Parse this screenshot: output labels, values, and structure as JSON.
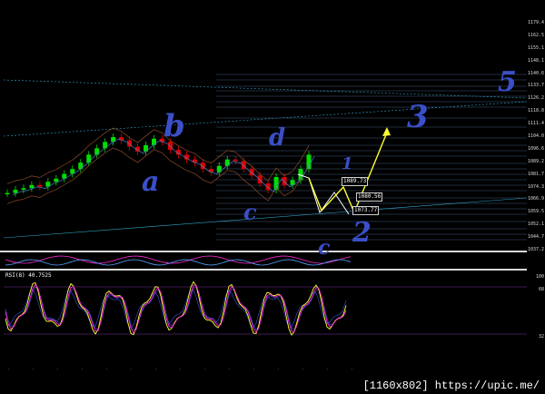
{
  "chart_data": [
    {
      "type": "line",
      "pane": "price",
      "y_axis_ticks": [
        1179.4,
        1162.5,
        1155.1,
        1148.1,
        1140.6,
        1133.7,
        1126.2,
        1118.8,
        1111.4,
        1104.0,
        1096.6,
        1089.2,
        1081.7,
        1074.3,
        1066.9,
        1059.5,
        1052.1,
        1044.7,
        1037.2
      ],
      "value_boxes": [
        "1089.73",
        "1080.56",
        "1073.77"
      ],
      "series": [
        {
          "values": [
            1071,
            1073,
            1074,
            1076,
            1075,
            1078,
            1080,
            1083,
            1086,
            1090,
            1095,
            1099,
            1103,
            1106,
            1104,
            1100,
            1097,
            1101,
            1105,
            1103,
            1098,
            1095,
            1092,
            1090,
            1086,
            1084,
            1088,
            1092,
            1091,
            1086,
            1082,
            1077,
            1073,
            1081,
            1076,
            1079,
            1086,
            1095
          ]
        }
      ]
    },
    {
      "type": "line",
      "pane": "rsi",
      "y_axis_ticks": [
        "100",
        "68",
        "32"
      ],
      "series": []
    }
  ],
  "rsi_title": "RSI(8) 40.7525",
  "annotations": {
    "wave_labels": [
      "b",
      "a",
      "d",
      "c",
      "1",
      "2",
      "3",
      "5"
    ]
  },
  "footer_text": "[1160x802] https://upic.me/",
  "colors": {
    "bull": "#00e000",
    "bear": "#e00000",
    "fib": "#5a7fa8",
    "trend": "#2fa4c9",
    "wave": "#ffffff",
    "arrow": "#ffff33",
    "handwriting": "#3a4fc8",
    "rsi_fast": "#ff2bd6",
    "rsi_slow": "#ffff33",
    "rsi_band": "#3d4fd8"
  }
}
